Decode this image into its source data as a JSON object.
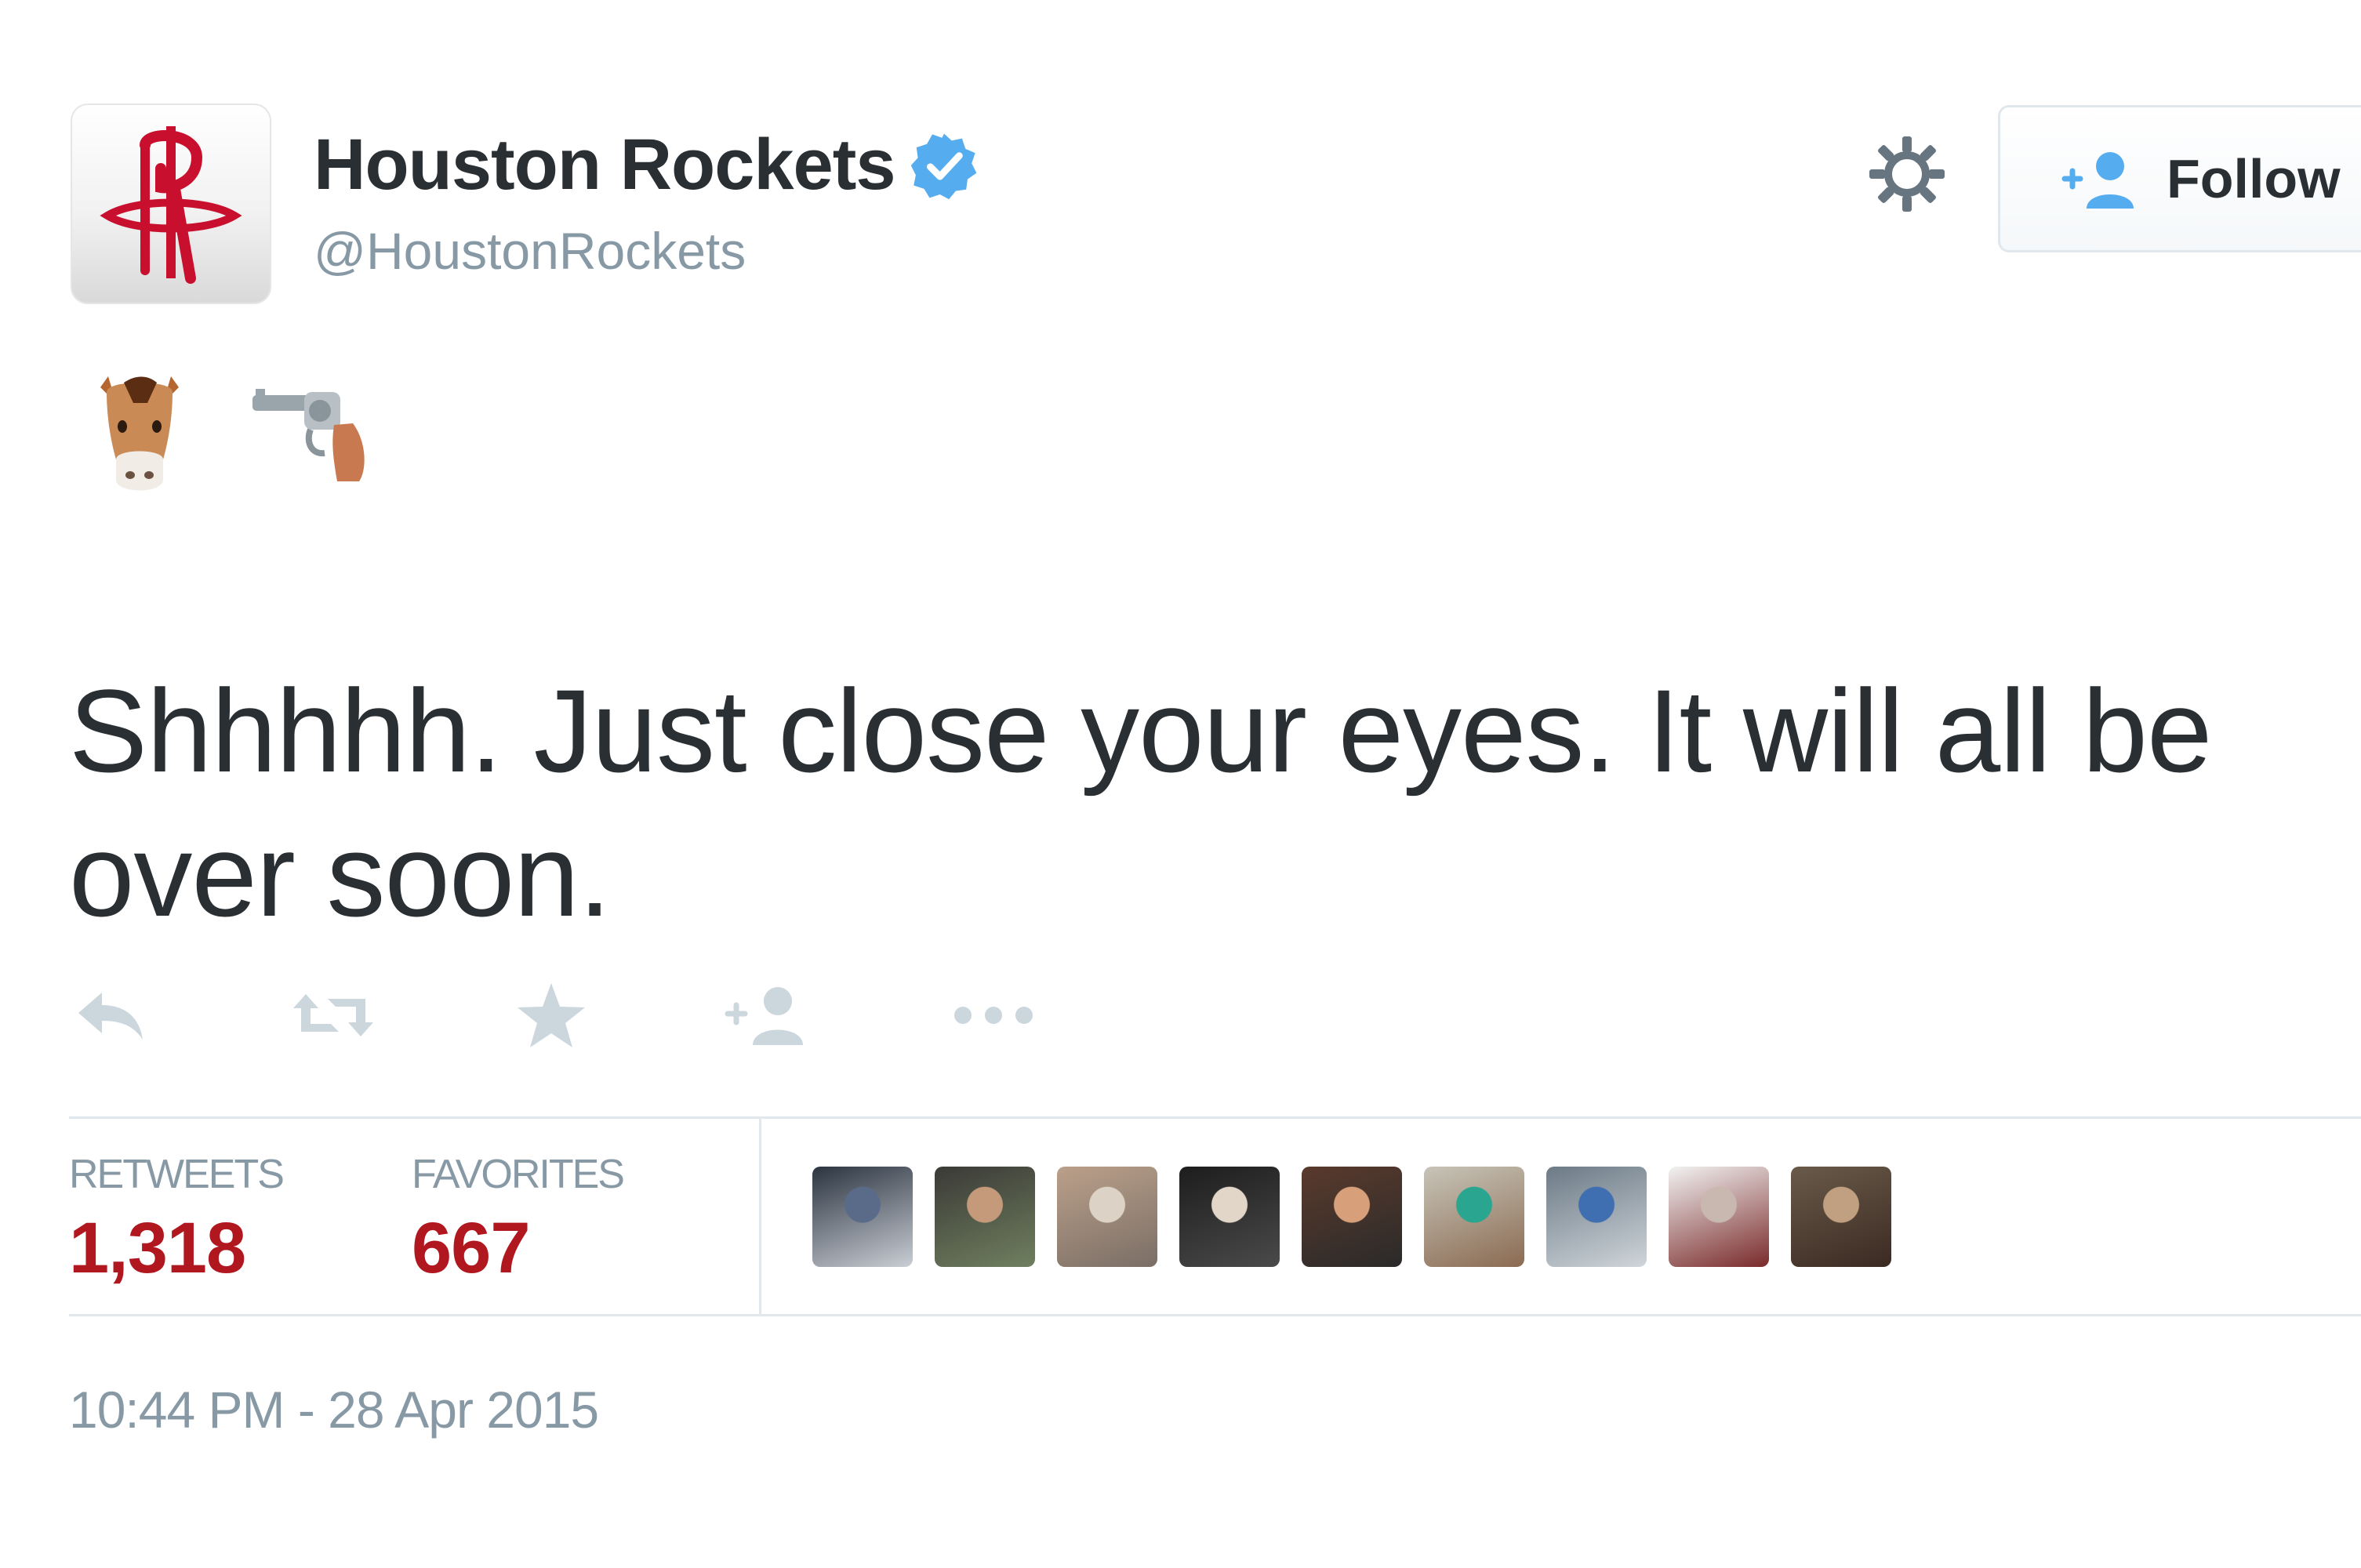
{
  "account": {
    "display_name": "Houston Rockets",
    "handle": "@HoustonRockets",
    "verified": true,
    "verified_icon": "verified-badge-icon",
    "avatar_icon": "houston-rockets-logo"
  },
  "header": {
    "settings_icon": "gear-icon",
    "follow_label": "Follow",
    "follow_icon": "add-user-icon"
  },
  "tweet": {
    "emojis": [
      "horse-face-emoji",
      "pistol-emoji"
    ],
    "text": "Shhhhh. Just close your eyes. It will all be over soon.",
    "timestamp": "10:44 PM - 28 Apr 2015"
  },
  "actions": [
    "reply-icon",
    "retweet-icon",
    "favorite-icon",
    "follow-icon",
    "more-icon"
  ],
  "stats": {
    "retweets_label": "RETWEETS",
    "retweets_value": "1,318",
    "favorites_label": "FAVORITES",
    "favorites_value": "667"
  },
  "colors": {
    "accent_red": "#b1171f",
    "muted_gray": "#8899a6",
    "verified_blue": "#55acee",
    "text_dark": "#292f33"
  },
  "favoriter_avatars": [
    {
      "colors": [
        "#2b3440",
        "#5a6b8a",
        "#c9cdd4"
      ]
    },
    {
      "colors": [
        "#3b3a36",
        "#c49a7a",
        "#6f7f5f"
      ]
    },
    {
      "colors": [
        "#bba08a",
        "#dcd3c6",
        "#7a6e66"
      ]
    },
    {
      "colors": [
        "#1d1d1d",
        "#e2d6c8",
        "#4a4a4a"
      ]
    },
    {
      "colors": [
        "#5a3a2c",
        "#d8a07a",
        "#2a2a2a"
      ]
    },
    {
      "colors": [
        "#c7c4b8",
        "#2aa58f",
        "#8b6b52"
      ]
    },
    {
      "colors": [
        "#6c7a86",
        "#3f6fb0",
        "#cfd5da"
      ]
    },
    {
      "colors": [
        "#f2f2f2",
        "#c8b8b0",
        "#7a2a2a"
      ]
    },
    {
      "colors": [
        "#6a5a4a",
        "#c0a080",
        "#3a2a22"
      ]
    }
  ]
}
